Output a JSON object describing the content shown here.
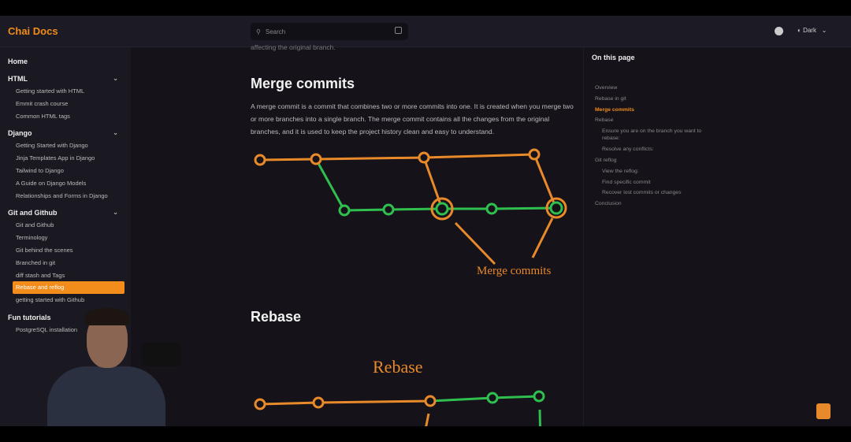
{
  "header": {
    "brand": "Chai Docs",
    "search_placeholder": "Search",
    "theme": "Dark"
  },
  "sidebar": {
    "home": "Home",
    "sections": [
      {
        "title": "HTML",
        "items": [
          "Getting started with HTML",
          "Emmit crash course",
          "Common HTML tags"
        ]
      },
      {
        "title": "Django",
        "items": [
          "Getting Started with Django",
          "Jinja Templates App in Django",
          "Tailwind to Django",
          "A Guide on Django Models",
          "Relationships and Forms in Django"
        ]
      },
      {
        "title": "Git and Github",
        "items": [
          "Git and Github",
          "Terminology",
          "Git behind the scenes",
          "Branched in git",
          "diff stash and Tags",
          "Rebase and reflog",
          "getting started with Github"
        ]
      },
      {
        "title": "Fun tutorials",
        "items": [
          "PostgreSQL installation"
        ]
      }
    ],
    "active_item": "Rebase and reflog"
  },
  "content": {
    "prev_text": "affecting the original branch.",
    "merge_title": "Merge commits",
    "merge_paragraph": "A merge commit is a commit that combines two or more commits into one. It is created when you merge two or more branches into a single branch. The merge commit contains all the changes from the original branches, and it is used to keep the project history clean and easy to understand.",
    "merge_diagram_label": "Merge commits",
    "rebase_title": "Rebase",
    "rebase_diagram_label": "Rebase"
  },
  "toc": {
    "title": "On this page",
    "items": [
      {
        "label": "Overview",
        "level": 1
      },
      {
        "label": "Rebase in git",
        "level": 1
      },
      {
        "label": "Merge commits",
        "level": 1,
        "active": true
      },
      {
        "label": "Rebase",
        "level": 1
      },
      {
        "label": "Ensure you are on the branch you want to rebase:",
        "level": 2
      },
      {
        "label": "Resolve any conflicts:",
        "level": 2
      },
      {
        "label": "Git reflog",
        "level": 1
      },
      {
        "label": "View the reflog:",
        "level": 2
      },
      {
        "label": "Find specific commit",
        "level": 2
      },
      {
        "label": "Recover lost commits or changes",
        "level": 2
      },
      {
        "label": "Conclusion",
        "level": 1
      }
    ]
  },
  "colors": {
    "accent": "#f28c1b",
    "branch_orange": "#e8892a",
    "branch_green": "#2fbf4f"
  }
}
